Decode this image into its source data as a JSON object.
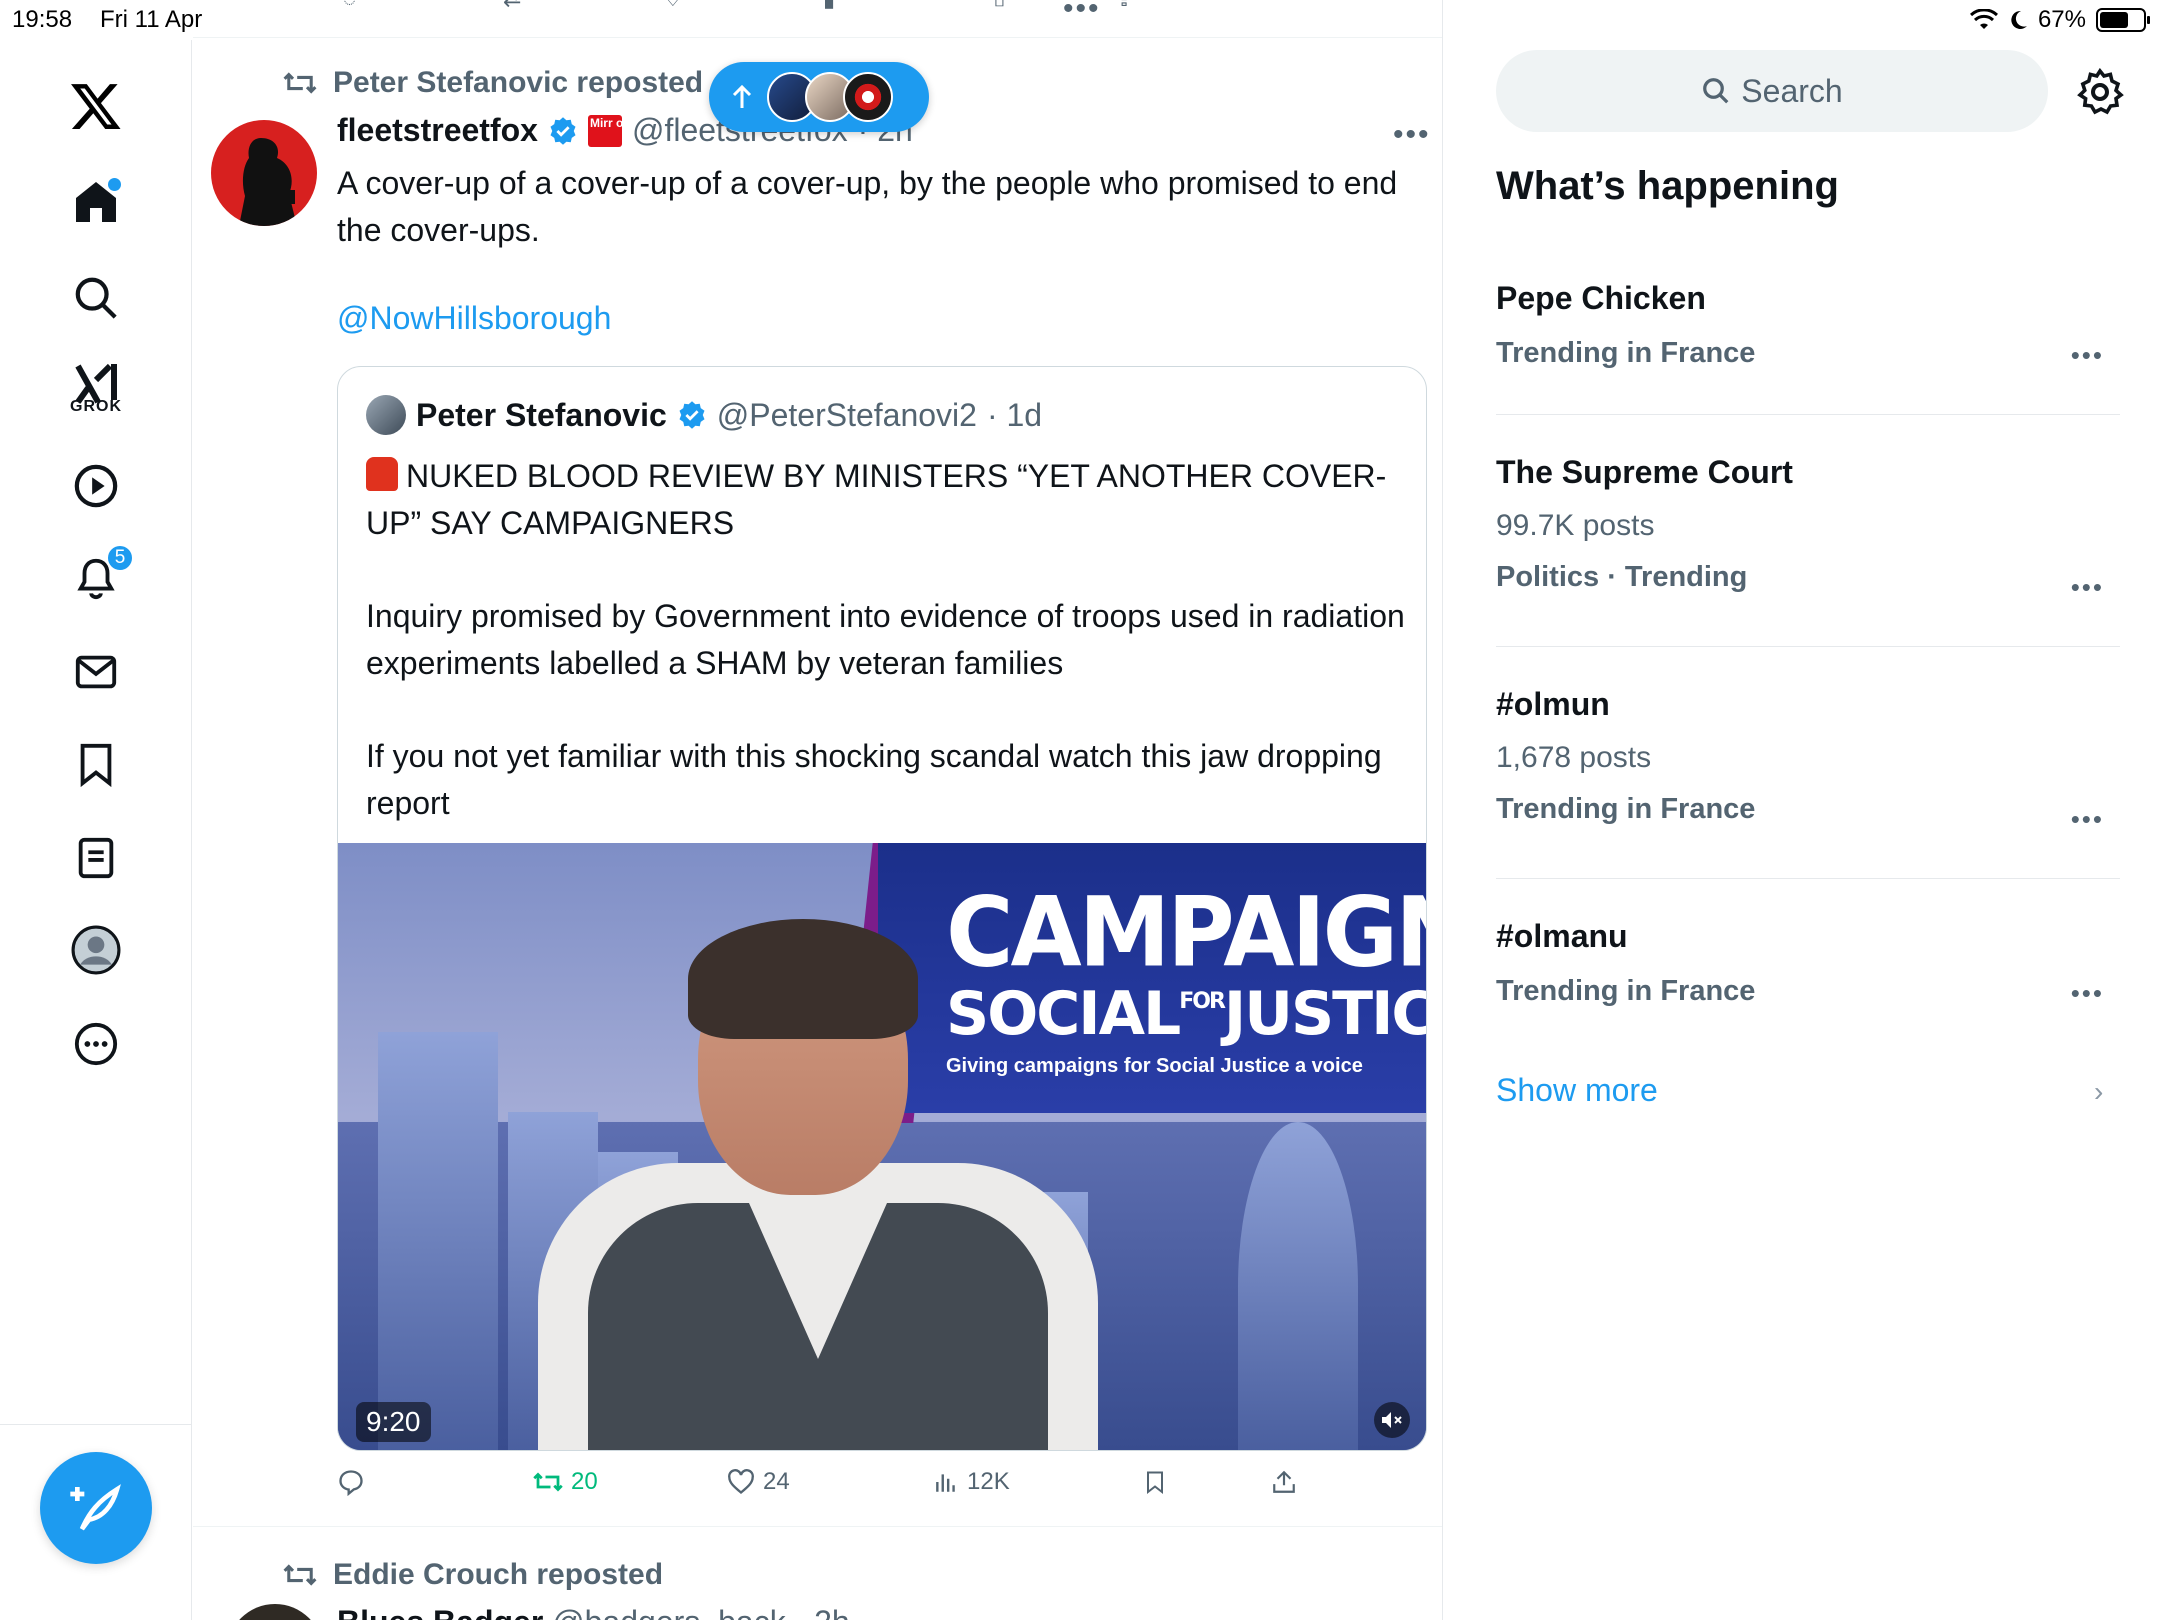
{
  "status_bar": {
    "time": "19:58",
    "date": "Fri 11 Apr",
    "battery": "67%",
    "battery_level": 0.67
  },
  "sidebar": {
    "grok_label": "GROK",
    "notifications_badge": "5",
    "items": [
      "home",
      "explore",
      "grok",
      "video",
      "notifications",
      "messages",
      "bookmarks",
      "lists",
      "profile",
      "more"
    ]
  },
  "feed": {
    "post": {
      "reposted_by": "Peter Stefanovic reposted",
      "author_name": "fleetstreetfox",
      "author_handle": "@fleetstreetfox",
      "time": "· 2h",
      "affiliate_label": "Mirr or",
      "text": "A cover-up of a cover-up of a cover-up, by the people who promised to end the cover-ups.",
      "mention": "@NowHillsborough",
      "quote": {
        "author_name": "Peter Stefanovic",
        "author_handle": "@PeterStefanovi2",
        "time": "· 1d",
        "headline": "NUKED BLOOD REVIEW BY MINISTERS “YET ANOTHER COVER-UP” SAY CAMPAIGNERS",
        "paragraph_1": "Inquiry promised by Government into evidence of troops used in radiation experiments labelled a SHAM by veteran families",
        "paragraph_2": "If you not yet familiar with this shocking scandal watch this jaw dropping report",
        "video": {
          "duration": "9:20",
          "banner_title": "CAMPAIGN",
          "banner_social": "SOCIAL",
          "banner_for": "FOR",
          "banner_justice": "JUSTICE",
          "banner_tagline": "Giving campaigns for Social Justice a voice"
        }
      },
      "actions": {
        "reply": "",
        "retweets": "20",
        "likes": "24",
        "views": "12K"
      }
    },
    "next_post": {
      "reposted_by": "Eddie Crouch reposted",
      "author_name": "Blues Badger",
      "author_handle": "@badgers_back",
      "time": "· 2h"
    }
  },
  "right": {
    "search_placeholder": "Search",
    "section_title": "What’s happening",
    "trends": [
      {
        "title": "Pepe Chicken",
        "count": "",
        "meta": "Trending in France"
      },
      {
        "title": "The Supreme Court",
        "count": "99.7K posts",
        "meta": "Politics · Trending"
      },
      {
        "title": "#olmun",
        "count": "1,678 posts",
        "meta": "Trending in France"
      },
      {
        "title": "#olmanu",
        "count": "",
        "meta": "Trending in France"
      }
    ],
    "show_more": "Show more"
  },
  "colors": {
    "accent": "#1d9bf0",
    "secondary_text": "#536471",
    "retweet_green": "#00ba7c"
  }
}
